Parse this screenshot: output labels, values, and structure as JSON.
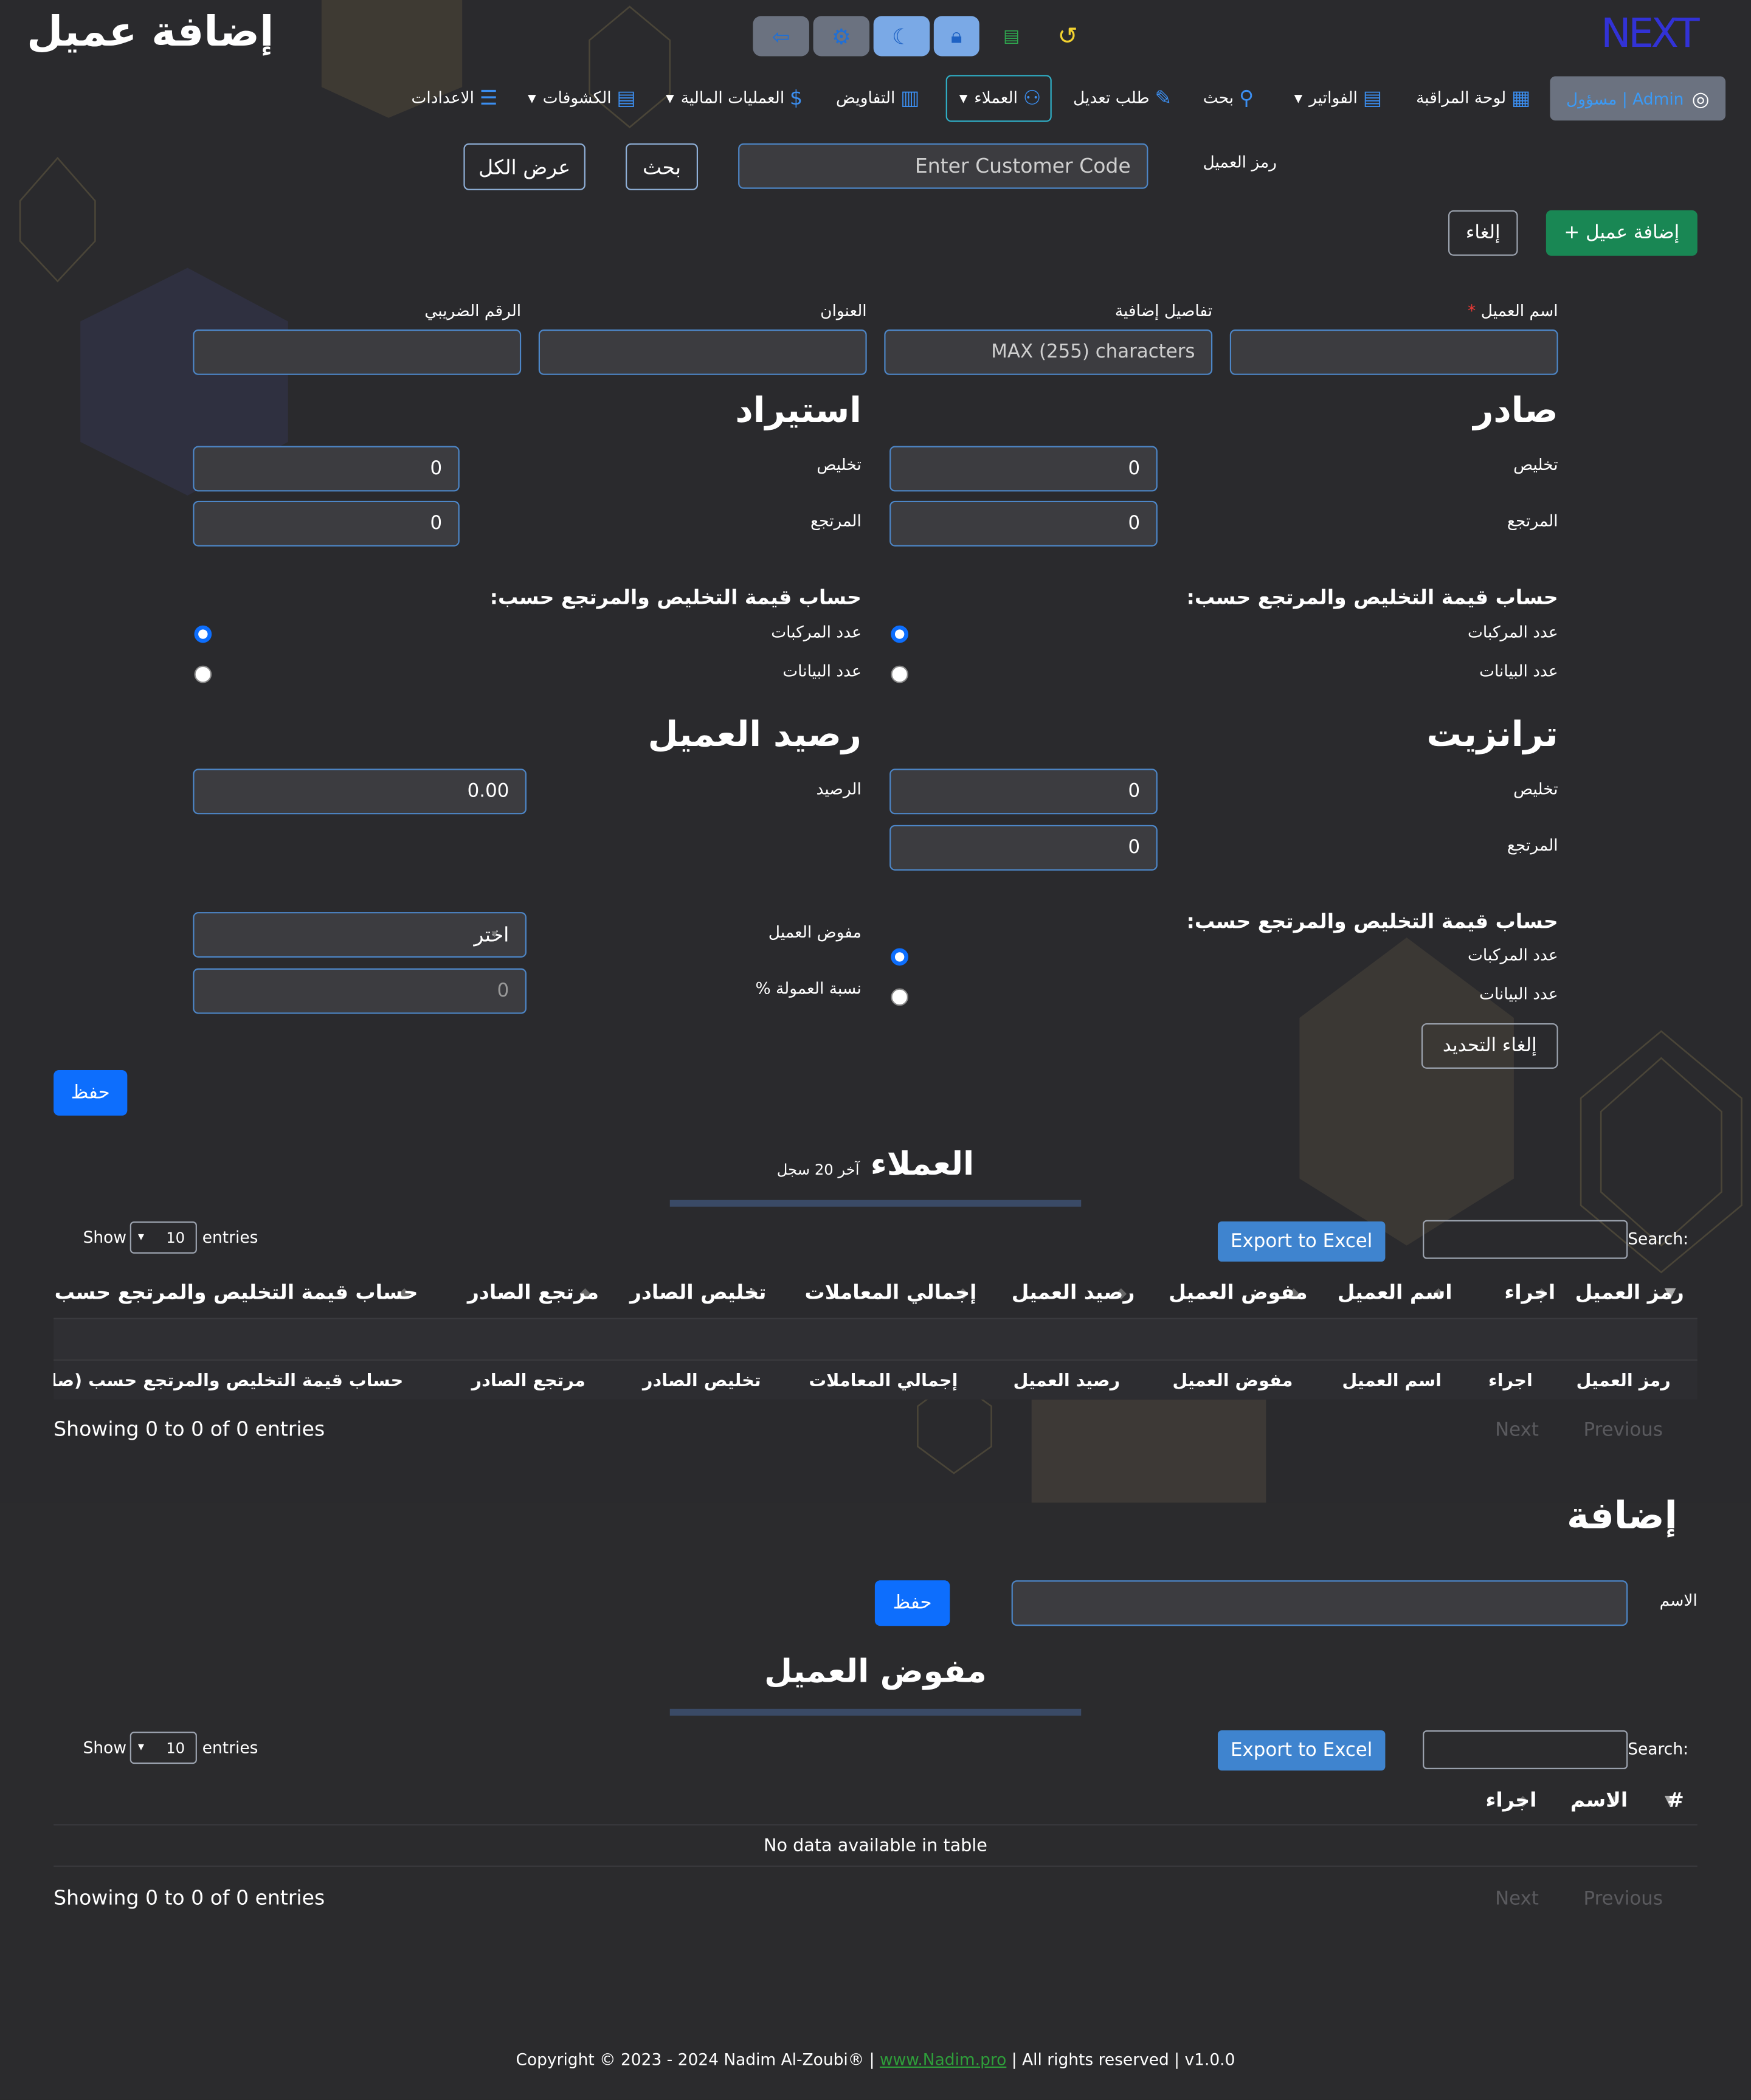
{
  "page": {
    "title": "إضافة عميل",
    "logo_text": "NEXT"
  },
  "toolbar_icons": [
    "logout-icon",
    "translate-icon",
    "moon-icon",
    "lock-icon",
    "csv-icon",
    "history-icon"
  ],
  "nav": {
    "admin_label": "Admin | مسؤول",
    "items": [
      {
        "label": "لوحة المراقبة",
        "icon": "dashboard-icon"
      },
      {
        "label": "الفواتير",
        "icon": "invoice-icon"
      },
      {
        "label": "بحث",
        "icon": "search-icon"
      },
      {
        "label": "طلب تعديل",
        "icon": "edit-icon"
      },
      {
        "label": "العملاء",
        "icon": "users-icon"
      },
      {
        "label": "التفاويض",
        "icon": "book-icon"
      },
      {
        "label": "العمليات المالية",
        "icon": "money-bag-icon"
      },
      {
        "label": "الكشوفات",
        "icon": "report-icon"
      },
      {
        "label": "الاعدادات",
        "icon": "sliders-icon"
      }
    ]
  },
  "search_bar": {
    "label": "رمز العميل",
    "placeholder": "Enter Customer Code",
    "search_btn": "بحث",
    "view_all_btn": "عرض الكل"
  },
  "actions": {
    "add_customer": "+ إضافة عميل",
    "cancel": "إلغاء"
  },
  "form": {
    "name_label": "اسم العميل",
    "required_mark": "*",
    "details_label": "تفاصيل إضافية",
    "details_placeholder": "MAX (255) characters",
    "address_label": "العنوان",
    "tax_label": "الرقم الضريبي",
    "export_title": "صادر",
    "import_title": "استيراد",
    "transit_title": "ترانزيت",
    "balance_title": "رصيد العميل",
    "clearance_label": "تخليص",
    "return_label": "المرتجع",
    "calc_by_label": "حساب قيمة التخليص والمرتجع حسب:",
    "by_vehicles": "عدد المركبات",
    "by_declarations": "عدد البيانات",
    "balance_label": "الرصيد",
    "delegate_label": "مفوض العميل",
    "commission_label": "نسبة العمولة %",
    "zero": "0",
    "balance_value": "0.00",
    "choose": "اختر",
    "clear_selection": "إلغاء التحديد",
    "save": "حفظ"
  },
  "customers_table": {
    "title": "العملاء",
    "subtitle": "آخر 20 سجل",
    "show": "Show",
    "entries": "entries",
    "page_size": "10",
    "search_label": "Search:",
    "export_btn": "Export to Excel",
    "columns": [
      "رمز العميل",
      "اجراء",
      "اسم العميل",
      "مفوض العميل",
      "رصيد العميل",
      "إجمالي المعاملات",
      "تخليص الصادر",
      "مرتجع الصادر",
      "حساب قيمة التخليص والمرتجع حسب (صادر)"
    ],
    "info": "Showing 0 to 0 of 0 entries",
    "next": "Next",
    "previous": "Previous"
  },
  "delegate_form": {
    "title": "إضافة",
    "name_label": "الاسم",
    "save": "حفظ"
  },
  "delegates_table": {
    "title": "مفوض العميل",
    "show": "Show",
    "entries": "entries",
    "page_size": "10",
    "search_label": "Search:",
    "export_btn": "Export to Excel",
    "columns": [
      "#",
      "الاسم",
      "اجراء"
    ],
    "empty": "No data available in table",
    "info": "Showing 0 to 0 of 0 entries",
    "next": "Next",
    "previous": "Previous"
  },
  "footer": {
    "pre": "Copyright © 2023 - 2024 Nadim Al-Zoubi® |",
    "link": "www.Nadim.pro",
    "post": "| All rights reserved | v1.0.0"
  },
  "colors": {
    "primary": "#0d6efd",
    "success": "#198754",
    "accent": "#3b8ef0",
    "bg": "#2b2b2d"
  }
}
